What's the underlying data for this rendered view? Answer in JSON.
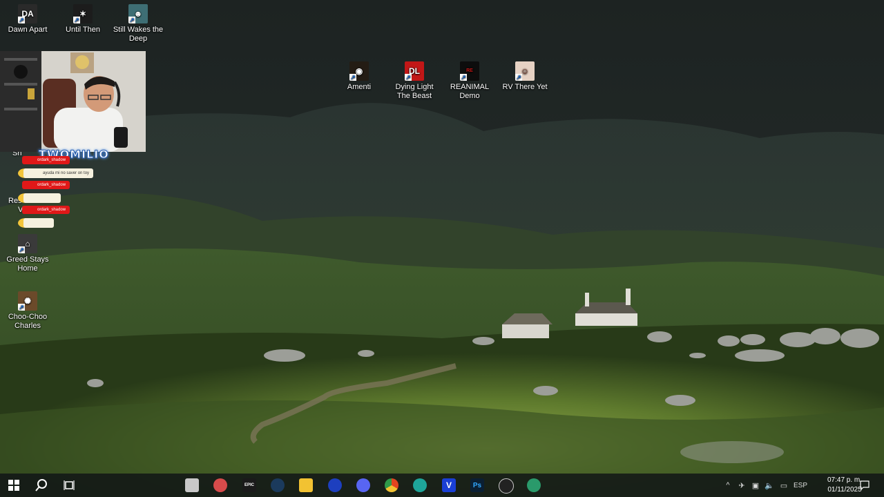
{
  "desktop": {
    "icons": [
      {
        "label": "Dawn Apart",
        "icon": "dawn-apart-icon",
        "bg": "#2a2a2a"
      },
      {
        "label": "Until Then",
        "icon": "until-then-icon",
        "bg": "#1c1c1c"
      },
      {
        "label": "Still Wakes the Deep",
        "icon": "still-wakes-icon",
        "bg": "#3e6e74"
      },
      {
        "label": "Amenti",
        "icon": "amenti-icon",
        "bg": "#241c14"
      },
      {
        "label": "Dying Light The Beast",
        "icon": "dying-light-icon",
        "bg": "#c21717"
      },
      {
        "label": "REANIMAL Demo",
        "icon": "reanimal-icon",
        "bg": "#0d0d0d"
      },
      {
        "label": "RV There Yet",
        "icon": "rv-there-yet-icon",
        "bg": "#e6d2c4"
      },
      {
        "label": "Greed Stays Home",
        "icon": "greed-stays-icon",
        "bg": "#3a3a3a"
      },
      {
        "label": "Choo-Choo Charles",
        "icon": "choo-choo-icon",
        "bg": "#6b4a2a"
      }
    ],
    "partial_labels": {
      "left_a": "Sh",
      "left_b": "Res",
      "left_c": "V"
    }
  },
  "overlay": {
    "streamer_name": "TWOMILIO",
    "chat": [
      {
        "user": "ordark_shadow",
        "message": "ayuda mi no saver on toy"
      },
      {
        "user": "ordark_shadow",
        "message": ""
      },
      {
        "user": "ordark_shadow",
        "message": ""
      }
    ]
  },
  "taskbar": {
    "apps": [
      {
        "name": "file-manager-icon",
        "bg": "#c8c8c8",
        "text": ""
      },
      {
        "name": "game-launcher-icon",
        "bg": "#d74b4b",
        "text": ""
      },
      {
        "name": "epic-games-icon",
        "bg": "#1a1a1a",
        "text": "EPIC"
      },
      {
        "name": "steam-icon",
        "bg": "#1b3a5c",
        "text": ""
      },
      {
        "name": "file-explorer-icon",
        "bg": "#f2c232",
        "text": ""
      },
      {
        "name": "media-icon",
        "bg": "#1d3fbf",
        "text": ""
      },
      {
        "name": "discord-icon",
        "bg": "#5865f2",
        "text": ""
      },
      {
        "name": "chrome-icon",
        "bg": "#e2a11f",
        "text": ""
      },
      {
        "name": "video-editor-icon",
        "bg": "#1ea59a",
        "text": ""
      },
      {
        "name": "v-app-icon",
        "bg": "#1a3fd6",
        "text": "V"
      },
      {
        "name": "photoshop-icon",
        "bg": "#0b1f33",
        "text": "Ps"
      },
      {
        "name": "obs-icon",
        "bg": "#222222",
        "text": ""
      },
      {
        "name": "recorder-icon",
        "bg": "#2a9a6b",
        "text": ""
      }
    ],
    "language": "ESP",
    "time": "07:47 p. m.",
    "date": "01/11/2025"
  }
}
